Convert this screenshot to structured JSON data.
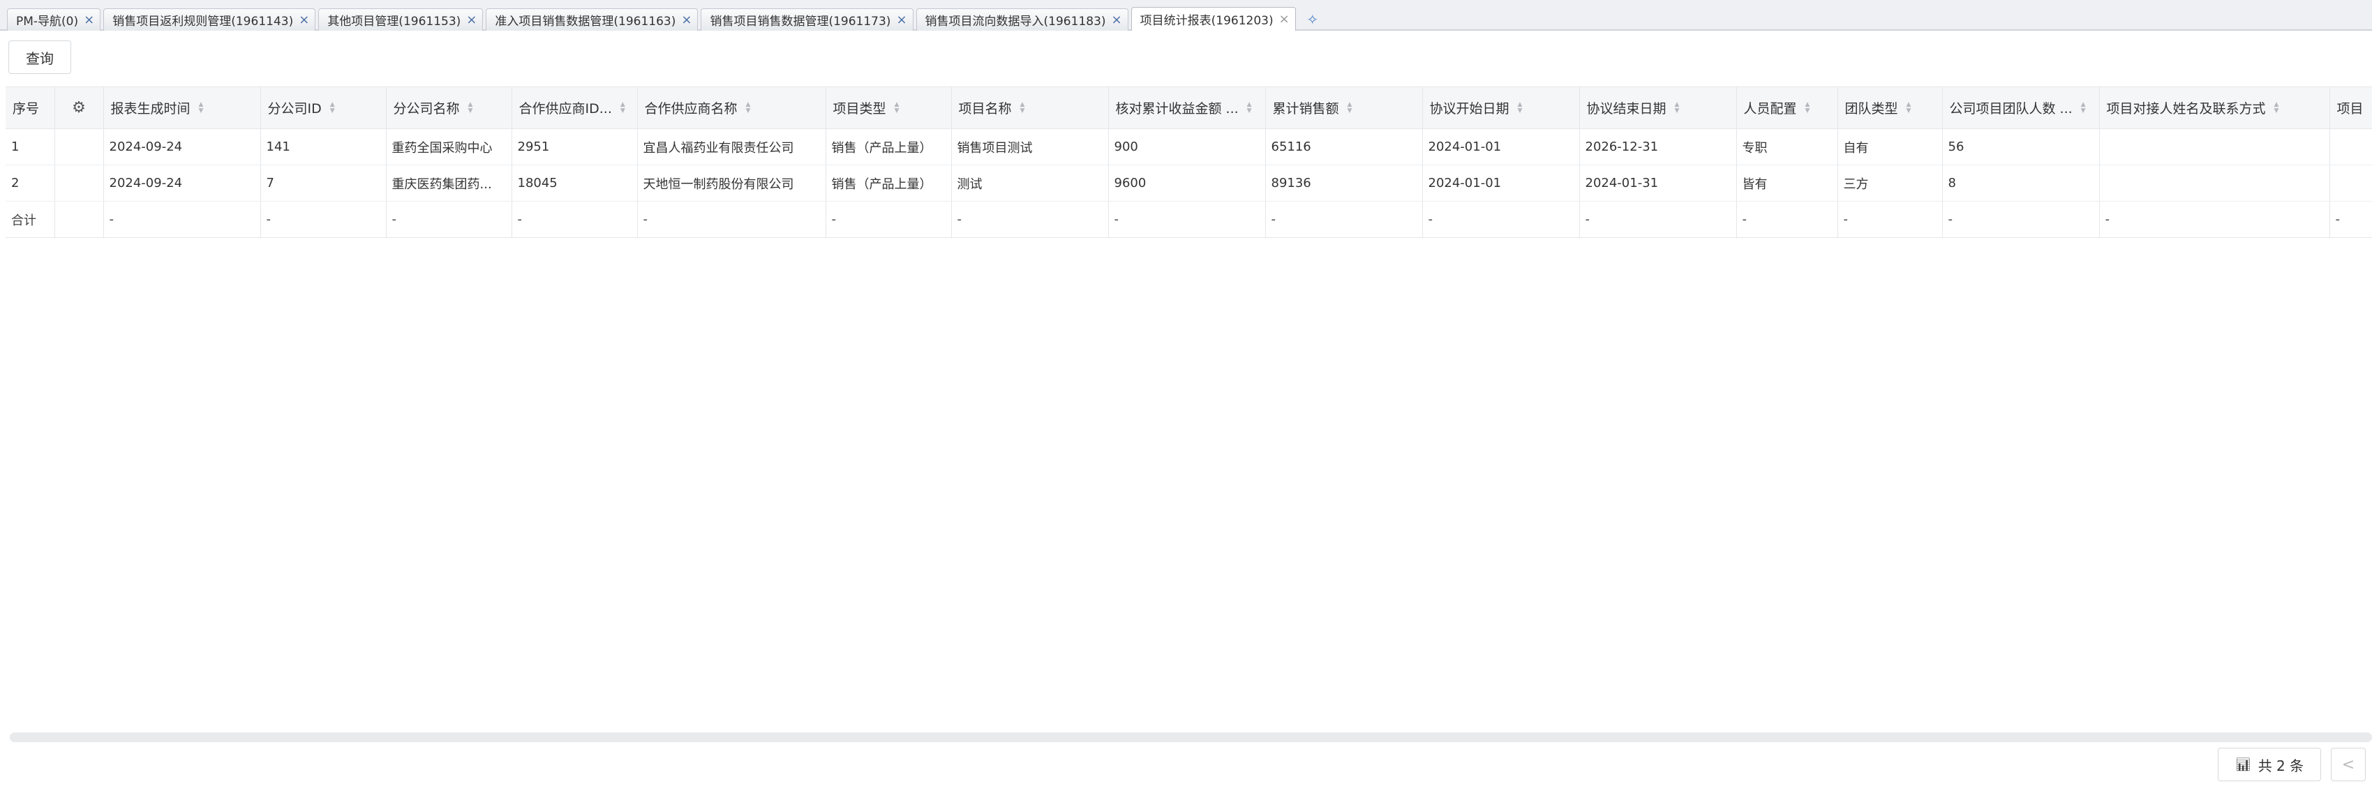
{
  "tabs": [
    {
      "label": "PM-导航(0)",
      "active": false
    },
    {
      "label": "销售项目返利规则管理(1961143)",
      "active": false
    },
    {
      "label": "其他项目管理(1961153)",
      "active": false
    },
    {
      "label": "准入项目销售数据管理(1961163)",
      "active": false
    },
    {
      "label": "销售项目销售数据管理(1961173)",
      "active": false
    },
    {
      "label": "销售项目流向数据导入(1961183)",
      "active": false
    },
    {
      "label": "项目统计报表(1961203)",
      "active": true
    }
  ],
  "toolbar": {
    "query_label": "查询"
  },
  "table": {
    "columns": [
      "序号",
      "",
      "报表生成时间",
      "分公司ID",
      "分公司名称",
      "合作供应商ID...",
      "合作供应商名称",
      "项目类型",
      "项目名称",
      "核对累计收益金额 ...",
      "累计销售额",
      "协议开始日期",
      "协议结束日期",
      "人员配置",
      "团队类型",
      "公司项目团队人数 ...",
      "项目对接人姓名及联系方式",
      "项目"
    ],
    "rows": [
      [
        "1",
        "",
        "2024-09-24",
        "141",
        "重药全国采购中心",
        "2951",
        "宜昌人福药业有限责任公司",
        "销售（产品上量）",
        "销售项目测试",
        "900",
        "65116",
        "2024-01-01",
        "2026-12-31",
        "专职",
        "自有",
        "56",
        "",
        ""
      ],
      [
        "2",
        "",
        "2024-09-24",
        "7",
        "重庆医药集团药...",
        "18045",
        "天地恒一制药股份有限公司",
        "销售（产品上量）",
        "测试",
        "9600",
        "89136",
        "2024-01-01",
        "2024-01-31",
        "皆有",
        "三方",
        "8",
        "",
        ""
      ]
    ],
    "totals": [
      "合计",
      "",
      "-",
      "-",
      "-",
      "-",
      "-",
      "-",
      "-",
      "-",
      "-",
      "-",
      "-",
      "-",
      "-",
      "-",
      "-",
      "-"
    ]
  },
  "footer": {
    "total_label": "共 2 条",
    "prev_label": "<"
  }
}
